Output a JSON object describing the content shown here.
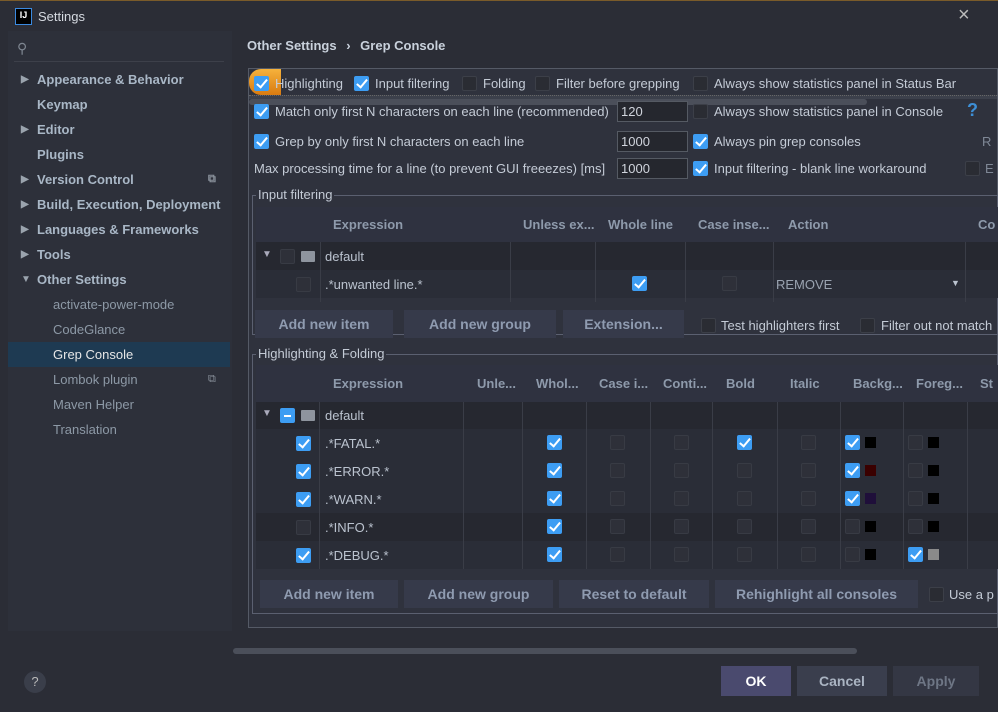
{
  "window": {
    "title": "Settings",
    "logo": "IJ"
  },
  "sidebar": {
    "search_icon": "search-icon",
    "items": [
      {
        "label": "Appearance & Behavior",
        "arrow": "right",
        "level": 0
      },
      {
        "label": "Keymap",
        "level": 0
      },
      {
        "label": "Editor",
        "arrow": "right",
        "level": 0
      },
      {
        "label": "Plugins",
        "level": 0
      },
      {
        "label": "Version Control",
        "arrow": "right",
        "level": 0,
        "badge": "copy-icon"
      },
      {
        "label": "Build, Execution, Deployment",
        "arrow": "right",
        "level": 0
      },
      {
        "label": "Languages & Frameworks",
        "arrow": "right",
        "level": 0
      },
      {
        "label": "Tools",
        "arrow": "right",
        "level": 0
      },
      {
        "label": "Other Settings",
        "arrow": "down",
        "level": 0
      },
      {
        "label": "activate-power-mode",
        "level": 1
      },
      {
        "label": "CodeGlance",
        "level": 1
      },
      {
        "label": "Grep Console",
        "level": 1,
        "selected": true
      },
      {
        "label": "Lombok plugin",
        "level": 1,
        "badge": "copy-icon"
      },
      {
        "label": "Maven Helper",
        "level": 1
      },
      {
        "label": "Translation",
        "level": 1
      }
    ]
  },
  "breadcrumb": {
    "parent": "Other Settings",
    "separator": "›",
    "current": "Grep Console"
  },
  "options": {
    "highlighting": {
      "label": "Highlighting",
      "checked": true
    },
    "input_filtering": {
      "label": "Input filtering",
      "checked": true
    },
    "folding": {
      "label": "Folding",
      "checked": false
    },
    "filter_before": {
      "label": "Filter before grepping",
      "checked": false
    },
    "stats_status": {
      "label": "Always show statistics panel in Status Bar",
      "checked": false
    },
    "match_first": {
      "label": "Match only first N characters on each line (recommended)",
      "checked": true,
      "value": "120"
    },
    "stats_console": {
      "label": "Always show statistics panel in Console",
      "checked": false
    },
    "grep_first": {
      "label": "Grep by only first N characters on each line",
      "checked": true,
      "value": "1000"
    },
    "pin": {
      "label": "Always pin grep consoles",
      "checked": true
    },
    "max_time": {
      "label": "Max processing time for a line (to prevent GUI freeezes) [ms]",
      "value": "1000"
    },
    "blank_line": {
      "label": "Input filtering - blank line workaround",
      "checked": true
    },
    "help": "?",
    "cut_r": "R",
    "cut_e": "E"
  },
  "input_filtering": {
    "title": "Input filtering",
    "columns": [
      "Expression",
      "Unless ex...",
      "Whole line",
      "Case inse...",
      "Action",
      "Co"
    ],
    "group": {
      "label": "default",
      "checked": false
    },
    "rows": [
      {
        "expression": ".*unwanted line.*",
        "enabled": false,
        "whole_line": true,
        "case_insensitive": false,
        "action": "REMOVE"
      }
    ],
    "buttons": [
      "Add new item",
      "Add new group",
      "Extension..."
    ],
    "test_first": {
      "label": "Test highlighters first",
      "checked": false
    },
    "filter_out": {
      "label": "Filter out not match",
      "checked": false
    }
  },
  "highlighting": {
    "title": "Highlighting & Folding",
    "columns": [
      "Expression",
      "Unle...",
      "Whol...",
      "Case i...",
      "Conti...",
      "Bold",
      "Italic",
      "Backg...",
      "Foreg...",
      "St"
    ],
    "group": {
      "label": "default",
      "state": "mixed"
    },
    "rows": [
      {
        "expression": ".*FATAL.*",
        "enabled": true,
        "whole": true,
        "case": false,
        "cont": false,
        "bold": true,
        "italic": false,
        "bg_on": true,
        "bg": "#000000",
        "fg_on": false,
        "fg": "#000000"
      },
      {
        "expression": ".*ERROR.*",
        "enabled": true,
        "whole": true,
        "case": false,
        "cont": false,
        "bold": false,
        "italic": false,
        "bg_on": true,
        "bg": "#3a0000",
        "fg_on": false,
        "fg": "#000000"
      },
      {
        "expression": ".*WARN.*",
        "enabled": true,
        "whole": true,
        "case": false,
        "cont": false,
        "bold": false,
        "italic": false,
        "bg_on": true,
        "bg": "#1f0f3a",
        "fg_on": false,
        "fg": "#000000"
      },
      {
        "expression": ".*INFO.*",
        "enabled": false,
        "whole": true,
        "case": false,
        "cont": false,
        "bold": false,
        "italic": false,
        "bg_on": false,
        "bg": "#000000",
        "fg_on": false,
        "fg": "#000000"
      },
      {
        "expression": ".*DEBUG.*",
        "enabled": true,
        "whole": true,
        "case": false,
        "cont": false,
        "bold": false,
        "italic": false,
        "bg_on": false,
        "bg": "#000000",
        "fg_on": true,
        "fg": "#8a8a8a"
      }
    ],
    "buttons": [
      "Add new item",
      "Add new group",
      "Reset to default",
      "Rehighlight all consoles"
    ],
    "use_a": {
      "label": "Use a p",
      "checked": false
    }
  },
  "footer": {
    "help": "?",
    "ok": "OK",
    "cancel": "Cancel",
    "apply": "Apply"
  },
  "colors": {
    "accent": "#3d9df3",
    "selection": "#1e3a52",
    "ok_button": "#4a4a6e"
  }
}
